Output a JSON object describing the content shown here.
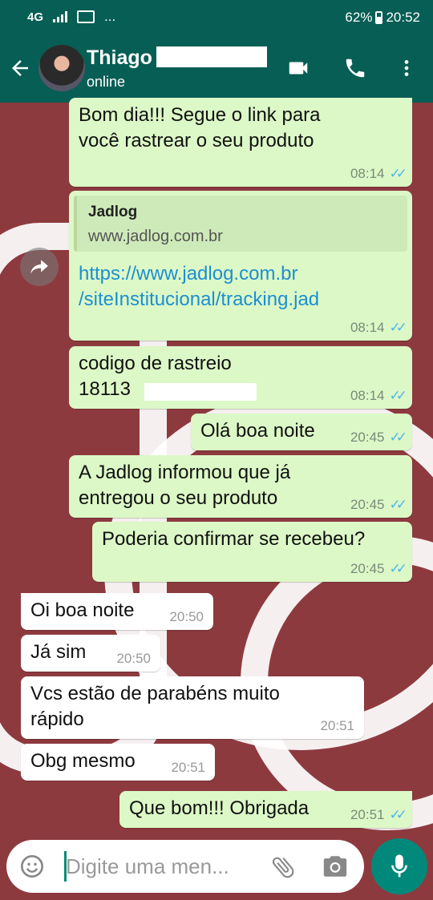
{
  "status": {
    "network": "4G",
    "more": "...",
    "battery": "62%",
    "time": "20:52"
  },
  "header": {
    "contact_name": "Thiago",
    "contact_status": "online",
    "icons": [
      "back-arrow-icon",
      "video-call-icon",
      "phone-icon",
      "menu-dots-icon"
    ]
  },
  "messages": [
    {
      "dir": "out",
      "text": "Bom dia!!! Segue o link para\nvocê rastrear o seu produto",
      "time": "08:14"
    },
    {
      "dir": "out",
      "preview_title": "Jadlog",
      "preview_url": "www.jadlog.com.br",
      "link": "https://www.jadlog.com.br\n/siteInstitucional/tracking.jad",
      "time": "08:14"
    },
    {
      "dir": "out",
      "text": "codigo de rastreio\n18113",
      "time": "08:14"
    },
    {
      "dir": "out",
      "text": "Olá boa noite",
      "time": "20:45"
    },
    {
      "dir": "out",
      "text": "A Jadlog informou que já\nentregou o seu produto",
      "time": "20:45"
    },
    {
      "dir": "out",
      "text": "Poderia confirmar se recebeu?",
      "time": "20:45"
    },
    {
      "dir": "in",
      "text": "Oi boa noite",
      "time": "20:50"
    },
    {
      "dir": "in",
      "text": "Já sim",
      "time": "20:50"
    },
    {
      "dir": "in",
      "text": "Vcs estão de parabéns muito\nrápido",
      "time": "20:51"
    },
    {
      "dir": "in",
      "text": "Obg mesmo",
      "time": "20:51"
    },
    {
      "dir": "out",
      "text": "Que bom!!! Obrigada",
      "time": "20:51"
    }
  ],
  "composer": {
    "placeholder": "Digite uma men...",
    "icons": [
      "emoji-icon",
      "attach-icon",
      "camera-icon",
      "mic-icon"
    ]
  },
  "colors": {
    "header": "#075e54",
    "outgoing_bubble": "#dcf8c6",
    "incoming_bubble": "#ffffff",
    "read_ticks": "#4fb6ec",
    "mic_button": "#00897b"
  }
}
